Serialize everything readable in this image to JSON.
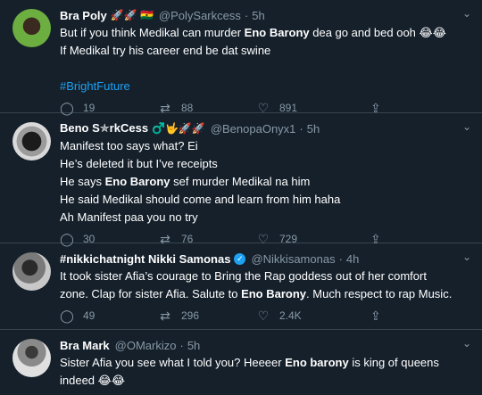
{
  "tweets": [
    {
      "name": "Bra Poly",
      "emoji": "🚀🚀 🇬🇭",
      "handle": "@PolySarkcess",
      "time": "5h",
      "lines": [
        [
          "But if you think Medikal can murder ",
          "Eno Barony",
          " dea go and bed ooh 😂😂"
        ],
        [
          "If Medikal try his career end be dat swine",
          "",
          ""
        ]
      ],
      "hashtag": "#BrightFuture",
      "replies": "19",
      "retweets": "88",
      "likes": "891"
    },
    {
      "name": "Beno S✯rkCess",
      "emoji": "♂️🤟🚀🚀",
      "handle": "@BenopaOnyx1",
      "time": "5h",
      "lines": [
        [
          "Manifest too says what? Ei",
          "",
          ""
        ],
        [
          "He’s deleted it but I’ve receipts",
          "",
          ""
        ],
        [
          "He says ",
          "Eno Barony",
          " sef murder Medikal na him"
        ],
        [
          "He said Medikal should come and learn from him haha",
          "",
          ""
        ],
        [
          "Ah Manifest paa you no try",
          "",
          ""
        ]
      ],
      "replies": "30",
      "retweets": "76",
      "likes": "729"
    },
    {
      "name": "#nikkichatnight Nikki Samonas",
      "verified_mark": "✓",
      "handle": "@Nikkisamonas",
      "time": "4h",
      "lines": [
        [
          "It took sister Afia’s courage to Bring the Rap goddess out of her comfort",
          "",
          ""
        ],
        [
          "zone.  Clap for sister Afia. Salute to ",
          "Eno Barony",
          ". Much respect to rap Music."
        ]
      ],
      "replies": "49",
      "retweets": "296",
      "likes": "2.4K"
    },
    {
      "name": "Bra Mark",
      "handle": "@OMarkizo",
      "time": "5h",
      "lines": [
        [
          "Sister Afia you see what I told you? Heeeer ",
          "Eno barony",
          " is king of queens"
        ],
        [
          "indeed 😂😂",
          "",
          ""
        ]
      ]
    }
  ],
  "colors": {
    "background": "#15202b",
    "muted": "#8899a6",
    "accent": "#1da1f2",
    "divider": "#38444d"
  },
  "icons": {
    "reply": "reply-icon",
    "retweet": "retweet-icon",
    "like": "heart-icon",
    "share": "share-icon",
    "caret": "chevron-down-icon"
  }
}
